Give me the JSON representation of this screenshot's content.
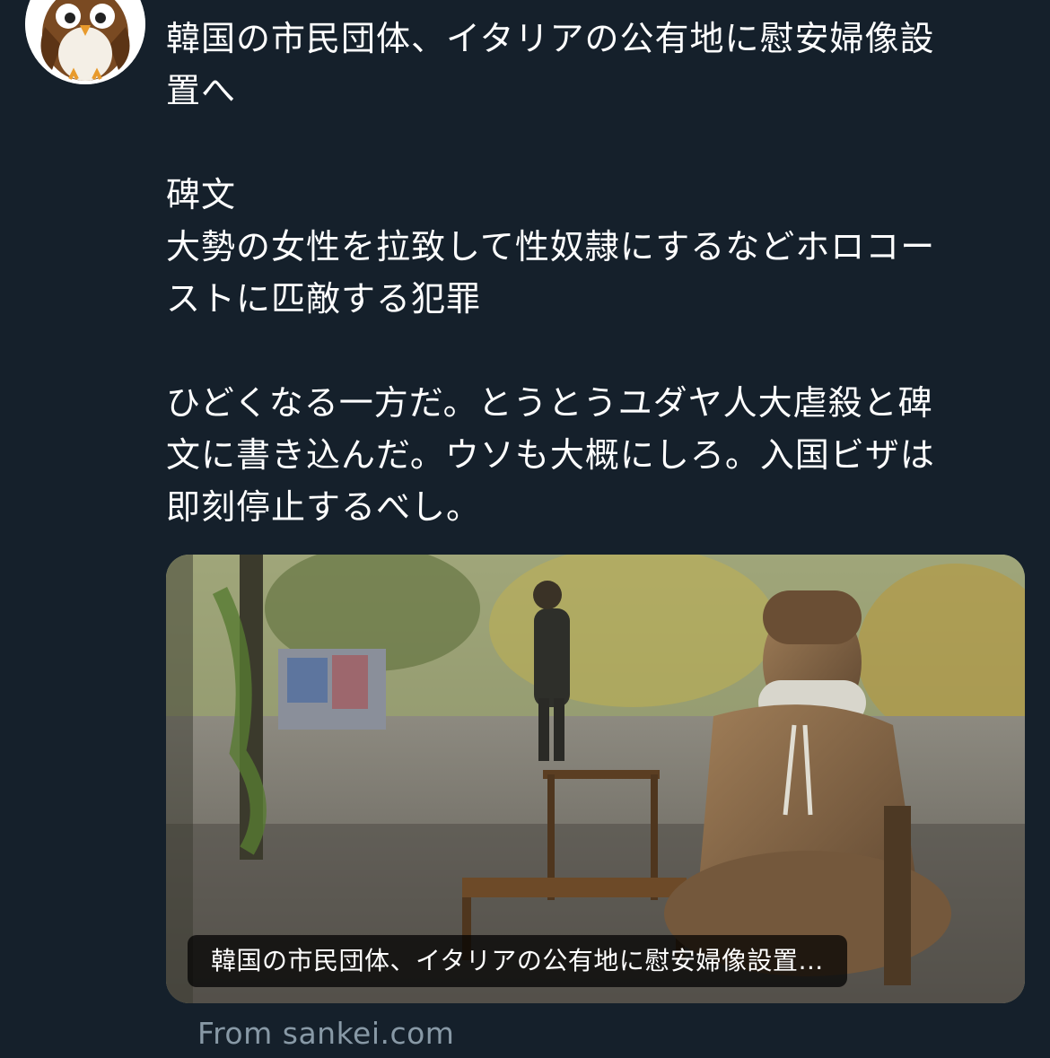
{
  "tweet": {
    "avatar_icon": "owl-avatar-icon",
    "paragraphs": [
      {
        "lines": [
          "韓国の市民団体、イタリアの公有地に慰安婦像設",
          "置へ"
        ]
      },
      {
        "lines": [
          "碑文",
          "大勢の女性を拉致して性奴隷にするなどホロコー",
          "ストに匹敵する犯罪"
        ]
      },
      {
        "lines": [
          "ひどくなる一方だ。とうとうユダヤ人大虐殺と碑",
          "文に書き込んだ。ウソも大概にしろ。入国ビザは",
          "即刻停止するべし。"
        ]
      }
    ]
  },
  "link_card": {
    "title": "韓国の市民団体、イタリアの公有地に慰安婦像設置…",
    "source": "From sankei.com"
  },
  "colors": {
    "background": "#15202b",
    "text": "#ffffff",
    "secondary_text": "#8899a6"
  }
}
